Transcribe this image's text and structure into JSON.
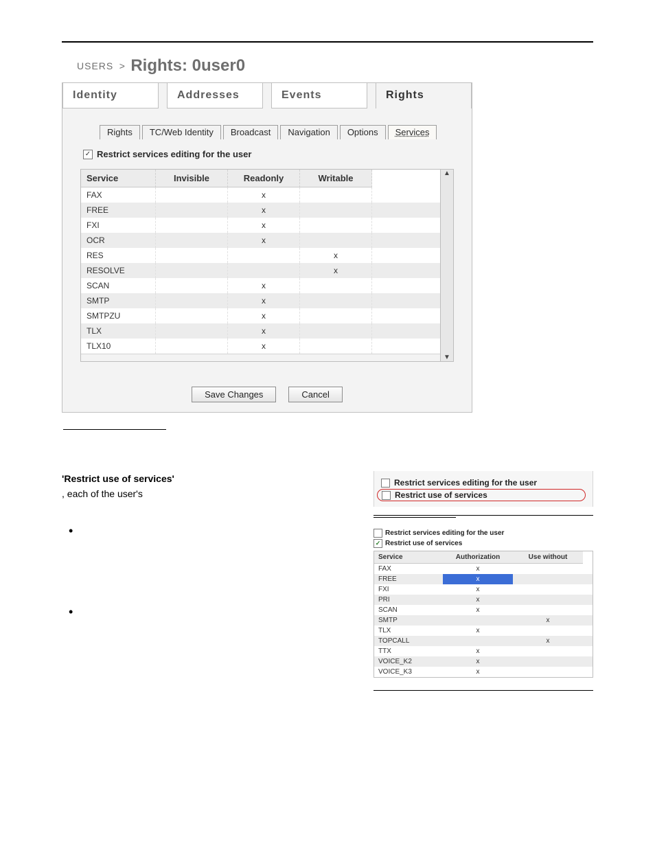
{
  "breadcrumb": {
    "root": "USERS",
    "sep": ">",
    "title": "Rights: 0user0"
  },
  "card": {
    "tabs": [
      "Identity",
      "Addresses",
      "Events",
      "Rights"
    ],
    "selected_tab": 3,
    "subtabs": [
      "Rights",
      "TC/Web Identity",
      "Broadcast",
      "Navigation",
      "Options",
      "Services"
    ],
    "selected_subtab": 5,
    "restrict_checkbox_checked": true,
    "restrict_checkbox_label": "Restrict services editing for the user",
    "headers": [
      "Service",
      "Invisible",
      "Readonly",
      "Writable"
    ],
    "rows": [
      {
        "service": "FAX",
        "invisible": "",
        "readonly": "x",
        "writable": ""
      },
      {
        "service": "FREE",
        "invisible": "",
        "readonly": "x",
        "writable": ""
      },
      {
        "service": "FXI",
        "invisible": "",
        "readonly": "x",
        "writable": ""
      },
      {
        "service": "OCR",
        "invisible": "",
        "readonly": "x",
        "writable": ""
      },
      {
        "service": "RES",
        "invisible": "",
        "readonly": "",
        "writable": "x"
      },
      {
        "service": "RESOLVE",
        "invisible": "",
        "readonly": "",
        "writable": "x"
      },
      {
        "service": "SCAN",
        "invisible": "",
        "readonly": "x",
        "writable": ""
      },
      {
        "service": "SMTP",
        "invisible": "",
        "readonly": "x",
        "writable": ""
      },
      {
        "service": "SMTPZU",
        "invisible": "",
        "readonly": "x",
        "writable": ""
      },
      {
        "service": "TLX",
        "invisible": "",
        "readonly": "x",
        "writable": ""
      },
      {
        "service": "TLX10",
        "invisible": "",
        "readonly": "x",
        "writable": ""
      }
    ],
    "buttons": {
      "save": "Save Changes",
      "cancel": "Cancel"
    }
  },
  "doc": {
    "strong_heading": "'Restrict use of services'",
    "tail_text": ", each of the user's"
  },
  "miniA": {
    "row1": "Restrict services editing for the user",
    "row2": "Restrict use of services"
  },
  "miniB": {
    "pre1": "Restrict services editing for the user",
    "pre2": "Restrict use of services",
    "pre2_checked": true,
    "headers": [
      "Service",
      "Authorization",
      "Use without"
    ],
    "rows": [
      {
        "service": "FAX",
        "auth": "x",
        "use": ""
      },
      {
        "service": "FREE",
        "auth": "x",
        "use": "",
        "sel": true
      },
      {
        "service": "FXI",
        "auth": "x",
        "use": ""
      },
      {
        "service": "PRI",
        "auth": "x",
        "use": ""
      },
      {
        "service": "SCAN",
        "auth": "x",
        "use": ""
      },
      {
        "service": "SMTP",
        "auth": "",
        "use": "x"
      },
      {
        "service": "TLX",
        "auth": "x",
        "use": ""
      },
      {
        "service": "TOPCALL",
        "auth": "",
        "use": "x"
      },
      {
        "service": "TTX",
        "auth": "x",
        "use": ""
      },
      {
        "service": "VOICE_K2",
        "auth": "x",
        "use": ""
      },
      {
        "service": "VOICE_K3",
        "auth": "x",
        "use": ""
      }
    ]
  }
}
